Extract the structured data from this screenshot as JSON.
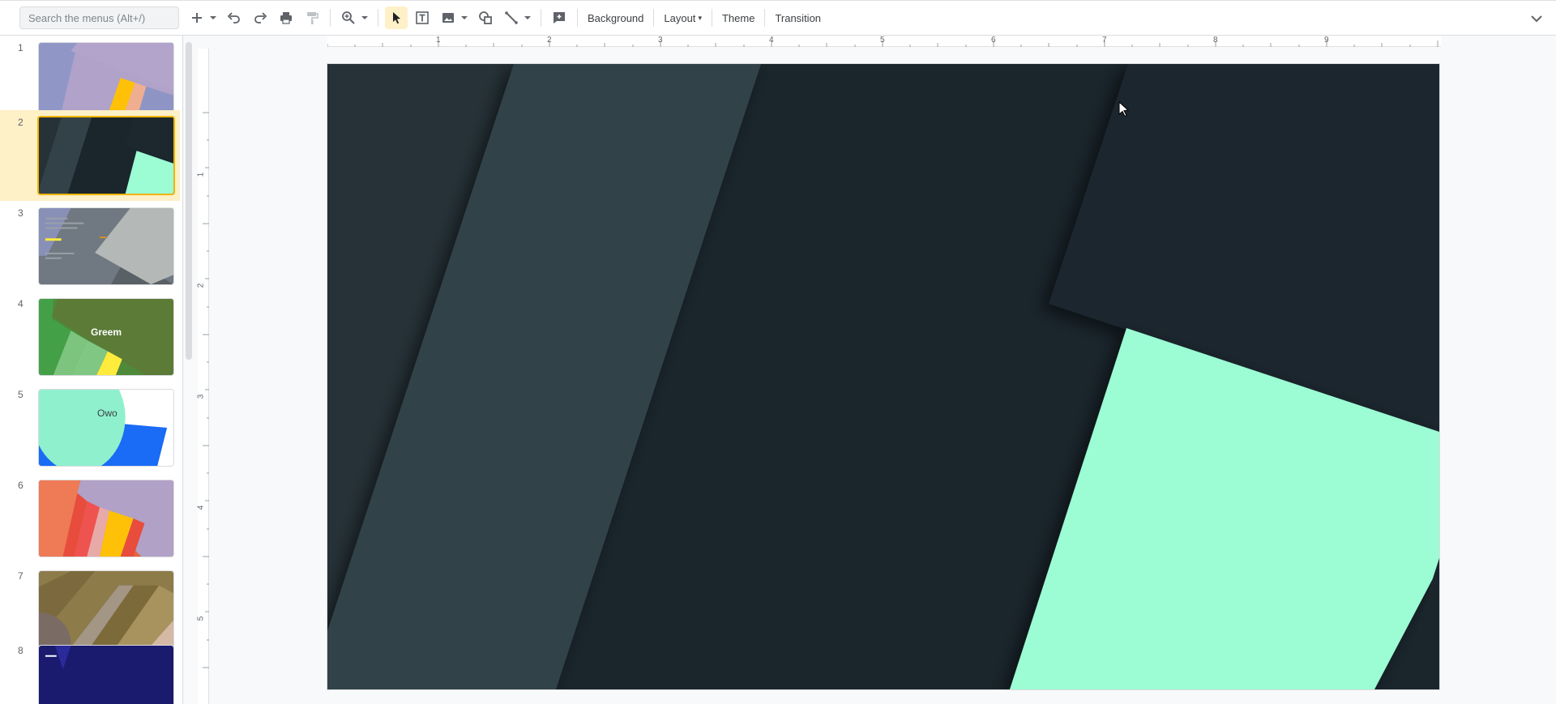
{
  "toolbar": {
    "search_placeholder": "Search the menus (Alt+/)",
    "background_label": "Background",
    "layout_label": "Layout",
    "theme_label": "Theme",
    "transition_label": "Transition"
  },
  "slides": [
    {
      "number": "1",
      "label": ""
    },
    {
      "number": "2",
      "label": ""
    },
    {
      "number": "3",
      "label": ""
    },
    {
      "number": "4",
      "label": "Greem"
    },
    {
      "number": "5",
      "label": "Owo"
    },
    {
      "number": "6",
      "label": ""
    },
    {
      "number": "7",
      "label": ""
    },
    {
      "number": "8",
      "label": ""
    }
  ],
  "ruler": {
    "horizontal": [
      "1",
      "2",
      "3",
      "4",
      "5",
      "6",
      "7",
      "8",
      "9"
    ],
    "vertical": [
      "1",
      "2",
      "3",
      "4",
      "5"
    ]
  },
  "colors": {
    "slide_bg": "#1a252c",
    "band_dark": "#263238",
    "band_mid": "#334249",
    "mint": "#9cfcd4",
    "selected_highlight": "#fef0c7",
    "accent": "#f0b400"
  }
}
